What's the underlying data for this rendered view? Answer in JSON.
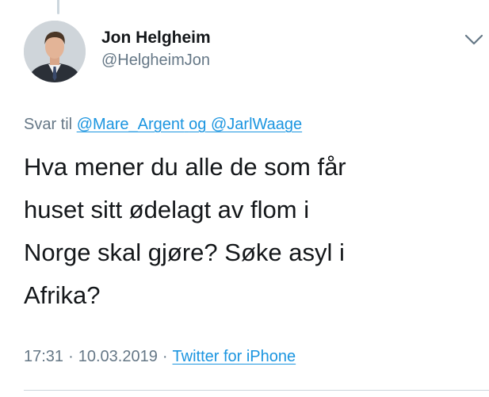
{
  "tweet": {
    "author": {
      "display_name": "Jon Helgheim",
      "handle": "@HelgheimJon"
    },
    "reply_prefix": "Svar til",
    "reply_mention_1": "@Mare_Argent",
    "reply_joiner": "og",
    "reply_mention_2": "@JarlWaage",
    "text": "Hva mener du alle de som får\nhuset sitt ødelagt av flom i\nNorge skal gjøre? Søke asyl i\nAfrika?",
    "time": "17:31",
    "date": "10.03.2019",
    "separator": "·",
    "source": "Twitter for iPhone"
  },
  "icons": {
    "caret": "chevron-down-icon",
    "avatar": "profile-photo"
  },
  "colors": {
    "text": "#14171a",
    "secondary": "#657786",
    "link": "#1b95e0",
    "divider": "#ccd6dd"
  }
}
